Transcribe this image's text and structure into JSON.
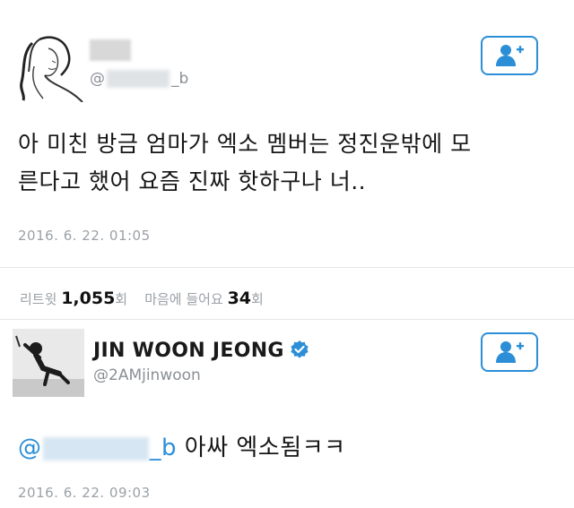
{
  "tweet1": {
    "handle_prefix": "@",
    "handle_suffix": "_b",
    "text_line1": "아 미친 방금 엄마가 엑소 멤버는 정진운밖에 모",
    "text_line2": "른다고 했어 요즘 진짜 핫하구나 너..",
    "date": "2016. 6. 22. 01:05"
  },
  "stats": {
    "retweet_label": "리트윗",
    "retweet_count": "1,055",
    "retweet_unit": "회",
    "like_label": "마음에 들어요",
    "like_count": "34",
    "like_unit": "회"
  },
  "tweet2": {
    "display_name": "JIN WOON JEONG",
    "handle": "@2AMjinwoon",
    "mention_prefix": "@",
    "mention_suffix": "_b",
    "reply_text": "아싸 엑소됨ㅋㅋ",
    "date": "2016. 6. 22. 09:03"
  },
  "icons": {
    "follow": "add-user-icon",
    "verified": "verified-badge-icon"
  },
  "colors": {
    "accent": "#2b8ed6",
    "muted": "#9ba1a6",
    "text": "#161616"
  }
}
